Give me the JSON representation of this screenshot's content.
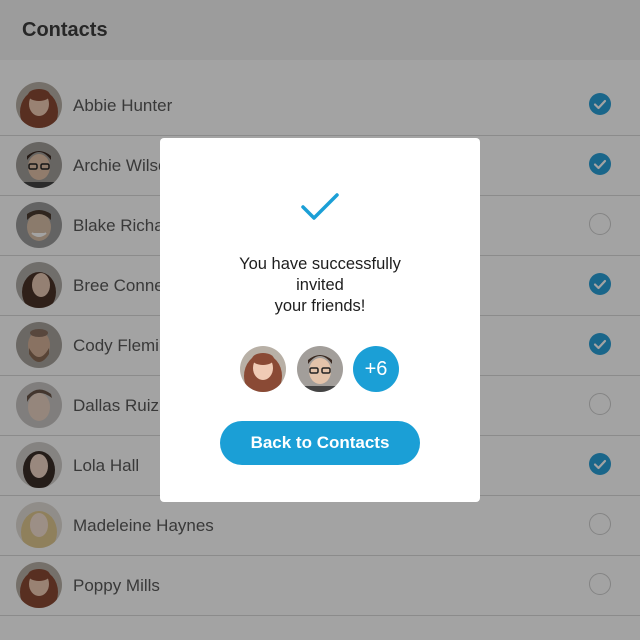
{
  "header": {
    "title": "Contacts"
  },
  "contacts": [
    {
      "name": "Abbie Hunter",
      "selected": true,
      "avatar": "female-auburn"
    },
    {
      "name": "Archie Wilson",
      "selected": true,
      "avatar": "male-glasses"
    },
    {
      "name": "Blake Richards",
      "selected": false,
      "avatar": "male-smiling"
    },
    {
      "name": "Bree Connelly",
      "selected": true,
      "avatar": "female-dark-hair"
    },
    {
      "name": "Cody Fleming",
      "selected": true,
      "avatar": "male-bearded"
    },
    {
      "name": "Dallas Ruiz",
      "selected": false,
      "avatar": "male-young"
    },
    {
      "name": "Lola Hall",
      "selected": true,
      "avatar": "female-dark-hair"
    },
    {
      "name": "Madeleine Haynes",
      "selected": false,
      "avatar": "female-blonde"
    },
    {
      "name": "Poppy Mills",
      "selected": false,
      "avatar": "female-auburn"
    }
  ],
  "modal": {
    "icon": "checkmark-icon",
    "message": "You have successfully\ninvited\nyour friends!",
    "more_count": "+6",
    "back_label": "Back to Contacts"
  },
  "colors": {
    "accent": "#1b9fd6",
    "check_on": "#2aa0d8"
  }
}
